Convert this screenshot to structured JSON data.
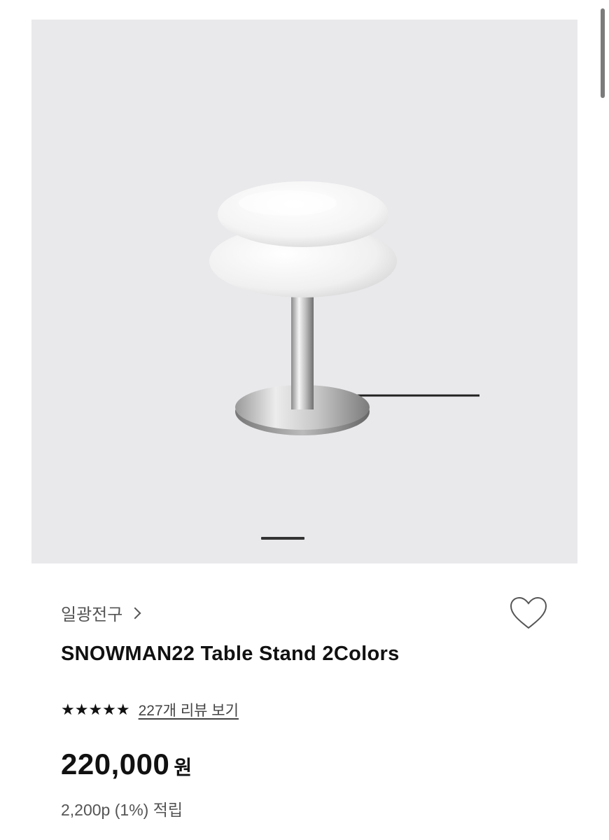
{
  "product": {
    "brand": "일광전구",
    "title": "SNOWMAN22 Table Stand 2Colors",
    "rating": 5,
    "stars": "★★★★★",
    "review_link": "227개 리뷰 보기",
    "price": "220,000",
    "currency": "원",
    "points": "2,200p (1%) 적립"
  },
  "gallery": {
    "image_name": "snowman-lamp-image",
    "slide_index": 1
  },
  "icons": {
    "wishlist": "heart-outline-icon",
    "brand_link": "chevron-right-icon"
  },
  "colors": {
    "gallery_bg": "#e9e9ec",
    "text": "#111111",
    "muted": "#555555"
  }
}
